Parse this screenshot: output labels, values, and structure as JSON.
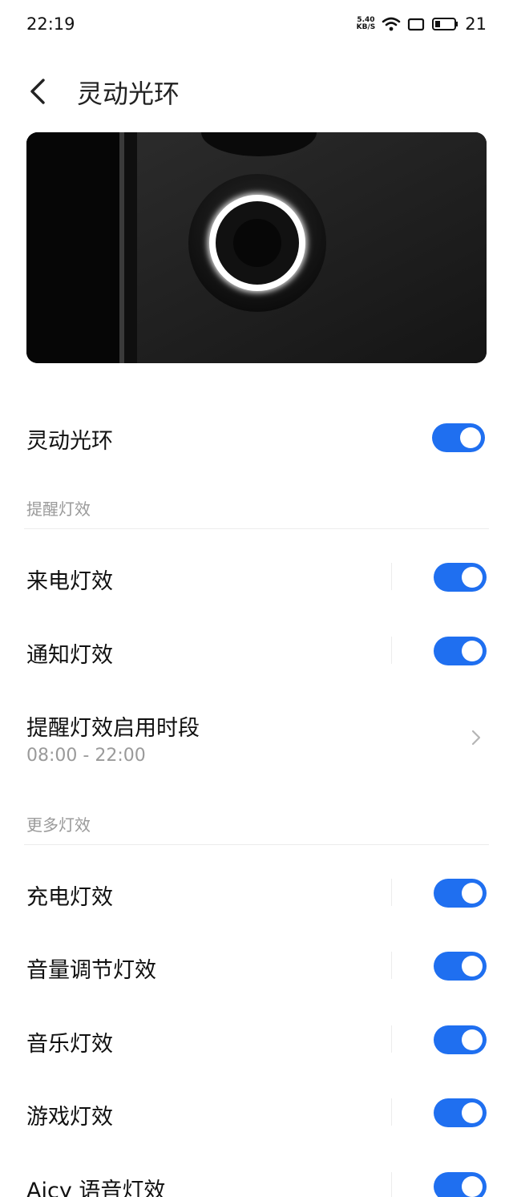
{
  "status_bar": {
    "time": "22:19",
    "speed_top": "5.40",
    "speed_bottom": "KB/S",
    "battery": "21"
  },
  "header": {
    "title": "灵动光环"
  },
  "master_toggle": {
    "label": "灵动光环",
    "on": true
  },
  "sections": {
    "reminder": {
      "label": "提醒灯效"
    },
    "more": {
      "label": "更多灯效"
    }
  },
  "reminder_items": [
    {
      "label": "来电灯效",
      "on": true
    },
    {
      "label": "通知灯效",
      "on": true
    }
  ],
  "schedule": {
    "label": "提醒灯效启用时段",
    "value": "08:00 - 22:00"
  },
  "more_items": [
    {
      "label": "充电灯效",
      "on": true
    },
    {
      "label": "音量调节灯效",
      "on": true
    },
    {
      "label": "音乐灯效",
      "on": true
    },
    {
      "label": "游戏灯效",
      "on": true
    },
    {
      "label": "Aicy 语音灯效",
      "on": true
    }
  ],
  "colors": {
    "accent": "#1f6ff0"
  }
}
